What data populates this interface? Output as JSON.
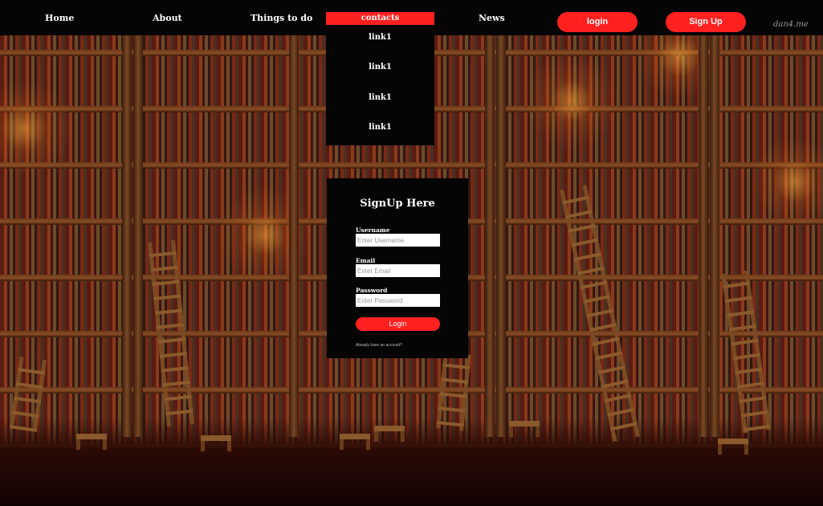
{
  "navbar": {
    "home": "Home",
    "about": "About",
    "things_to_do": "Things to do",
    "contacts": "contacts",
    "news": "News",
    "login_button": "login",
    "signup_button": "Sign Up",
    "watermark": "dan4.me"
  },
  "dropdown": {
    "items": [
      "link1",
      "link1",
      "link1",
      "link1"
    ]
  },
  "signup_form": {
    "title": "SignUp Here",
    "username_label": "Username",
    "username_placeholder": "Enter Username",
    "email_label": "Email",
    "email_placeholder": "Enter Email",
    "password_label": "Password",
    "password_placeholder": "Enter Password",
    "submit_label": "Login",
    "already_text": "Already have an account?"
  },
  "colors": {
    "accent": "#ff2020",
    "nav_background": "#050505",
    "form_background": "#050505"
  }
}
